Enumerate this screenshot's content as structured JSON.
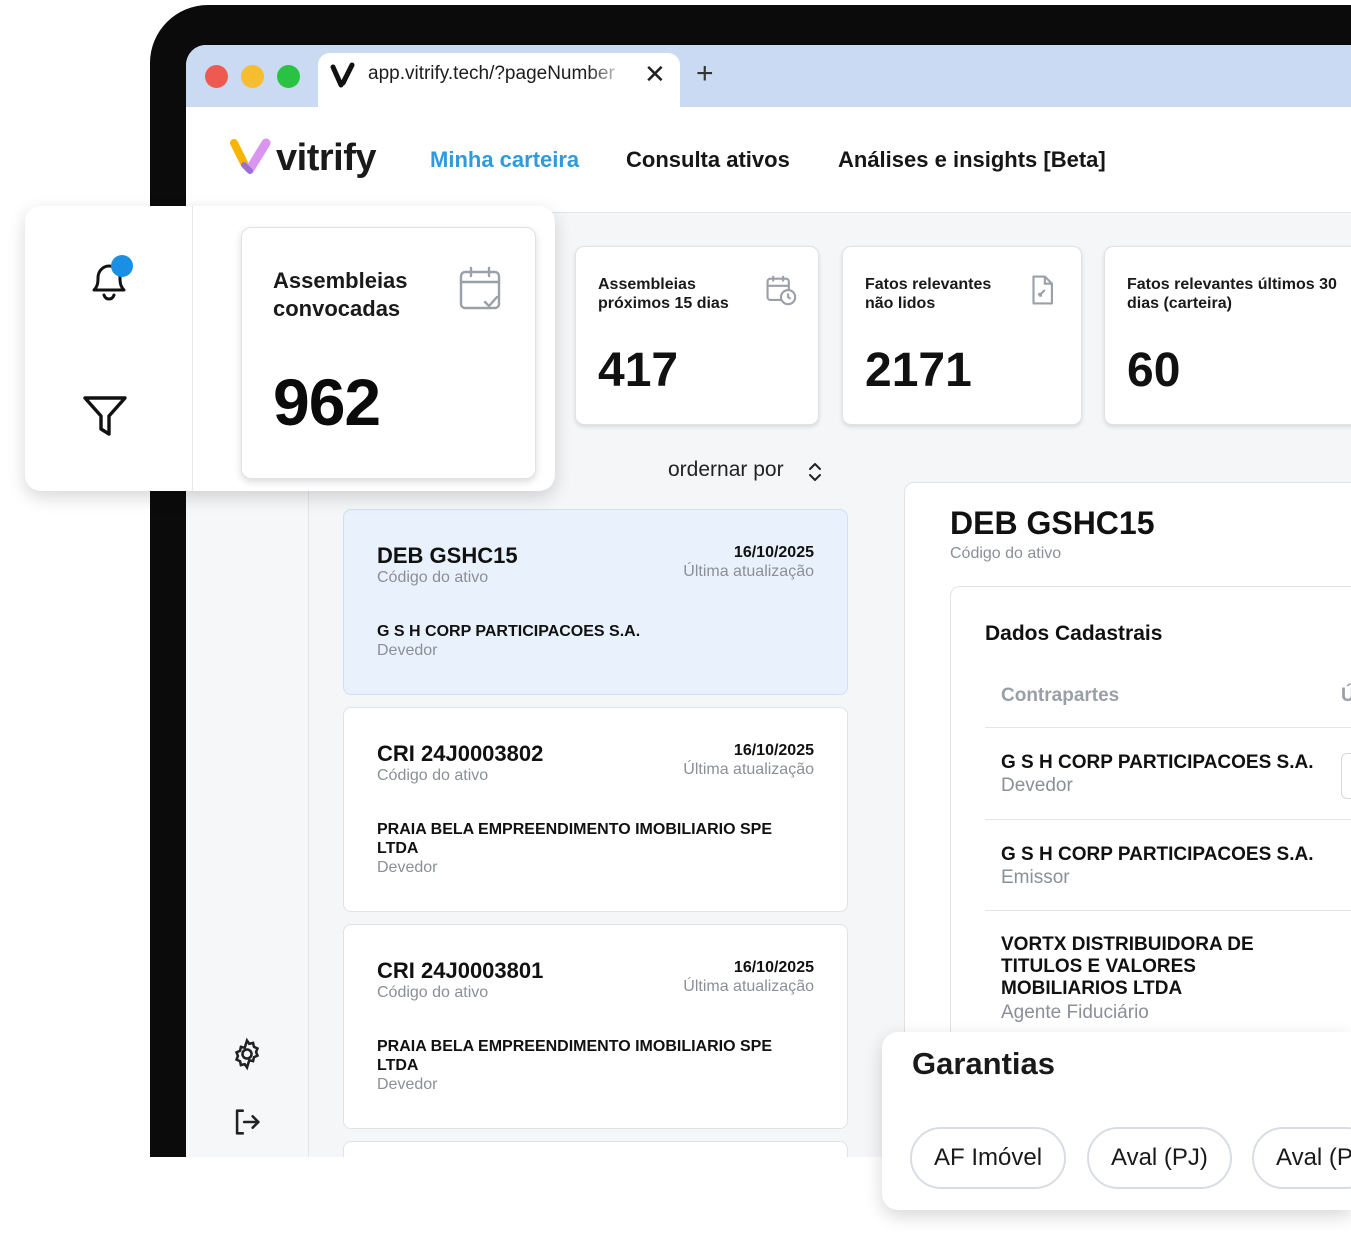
{
  "browser": {
    "tab_url": "app.vitrify.tech/?pageNumber",
    "close_glyph": "✕",
    "new_tab_glyph": "+"
  },
  "app": {
    "logo_text": "vitrify",
    "nav": [
      "Minha carteira",
      "Consulta ativos",
      "Análises e insights [Beta]"
    ],
    "active_nav": "Minha carteira",
    "accent_color": "#2e9bdb"
  },
  "stats": [
    {
      "title": "Assembleias convocadas",
      "value": "962",
      "icon": "calendar-check-icon"
    },
    {
      "title": "Assembleias próximos 15 dias",
      "value": "417",
      "icon": "calendar-clock-icon"
    },
    {
      "title": "Fatos relevantes não lidos",
      "value": "2171",
      "icon": "document-icon"
    },
    {
      "title": "Fatos relevantes últimos 30 dias (carteira)",
      "value": "60",
      "icon": ""
    }
  ],
  "sort": {
    "label": "ordernar por"
  },
  "assets": [
    {
      "code": "DEB GSHC15",
      "code_label": "Código do ativo",
      "date": "16/10/2025",
      "date_label": "Última atualização",
      "party": "G S H CORP PARTICIPACOES S.A.",
      "role": "Devedor",
      "selected": true
    },
    {
      "code": "CRI 24J0003802",
      "code_label": "Código do ativo",
      "date": "16/10/2025",
      "date_label": "Última atualização",
      "party": "PRAIA BELA EMPREENDIMENTO IMOBILIARIO SPE LTDA",
      "role": "Devedor",
      "selected": false
    },
    {
      "code": "CRI 24J0003801",
      "code_label": "Código do ativo",
      "date": "16/10/2025",
      "date_label": "Última atualização",
      "party": "PRAIA BELA EMPREENDIMENTO IMOBILIARIO SPE LTDA",
      "role": "Devedor",
      "selected": false
    }
  ],
  "detail": {
    "code": "DEB GSHC15",
    "code_label": "Código do ativo",
    "section_title": "Dados Cadastrais",
    "columns": [
      "Contrapartes",
      "Ú"
    ],
    "counterparties": [
      {
        "name": "G S H CORP PARTICIPACOES S.A.",
        "role": "Devedor"
      },
      {
        "name": "G S H CORP PARTICIPACOES S.A.",
        "role": "Emissor"
      },
      {
        "name": "VORTX DISTRIBUIDORA DE TITULOS E VALORES MOBILIARIOS LTDA",
        "role": "Agente Fiduciário"
      }
    ]
  },
  "garantias": {
    "title": "Garantias",
    "chips": [
      "AF Imóvel",
      "Aval (PJ)",
      "Aval (P"
    ]
  },
  "colors": {
    "notification_dot": "#1a8fe3",
    "selected_card_bg": "#e9f2fc",
    "tab_bar": "#c9daf2"
  }
}
